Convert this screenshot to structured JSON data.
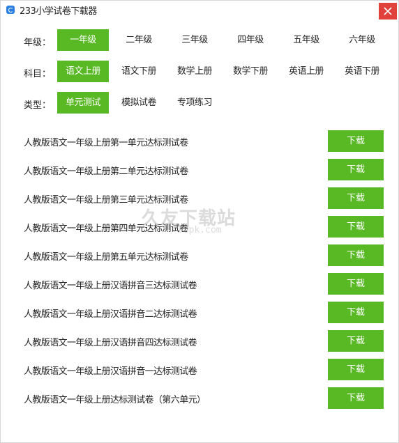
{
  "window": {
    "title": "233小学试卷下载器",
    "close_icon": "close-icon",
    "accent_color": "#58b924",
    "close_color": "#e0413a"
  },
  "filters": {
    "grade": {
      "label": "年级：",
      "options": [
        "一年级",
        "二年级",
        "三年级",
        "四年级",
        "五年级",
        "六年级"
      ],
      "selected": "一年级"
    },
    "subject": {
      "label": "科目：",
      "options": [
        "语文上册",
        "语文下册",
        "数学上册",
        "数学下册",
        "英语上册",
        "英语下册"
      ],
      "selected": "语文上册"
    },
    "type": {
      "label": "类型：",
      "options": [
        "单元测试",
        "模拟试卷",
        "专项练习"
      ],
      "selected": "单元测试"
    }
  },
  "papers": [
    {
      "title": "人教版语文一年级上册第一单元达标测试卷",
      "action": "下载"
    },
    {
      "title": "人教版语文一年级上册第二单元达标测试卷",
      "action": "下载"
    },
    {
      "title": "人教版语文一年级上册第三单元达标测试卷",
      "action": "下载"
    },
    {
      "title": "人教版语文一年级上册第四单元达标测试卷",
      "action": "下载"
    },
    {
      "title": "人教版语文一年级上册第五单元达标测试卷",
      "action": "下载"
    },
    {
      "title": " 人教版语文一年级上册汉语拼音三达标测试卷",
      "action": "下载"
    },
    {
      "title": "人教版语文一年级上册汉语拼音二达标测试卷",
      "action": "下载"
    },
    {
      "title": "人教版语文一年级上册汉语拼音四达标测试卷",
      "action": "下载"
    },
    {
      "title": "人教版语文一年级上册汉语拼音一达标测试卷",
      "action": "下载"
    },
    {
      "title": "人教版语文一年级上册达标测试卷（第六单元）",
      "action": "下载"
    }
  ],
  "watermark": {
    "main": "久友下载站",
    "sub": "9upk.com"
  }
}
